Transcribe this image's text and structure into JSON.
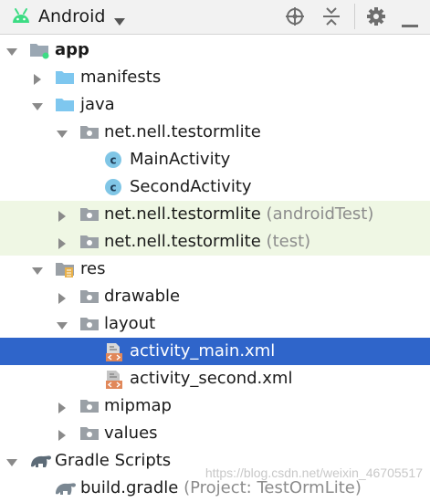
{
  "toolbar": {
    "view_icon": "android-icon",
    "view_label": "Android",
    "dropdown_icon": "chevron-down-icon",
    "actions": [
      "target-icon",
      "collapse-all-icon",
      "gear-icon",
      "hide-icon"
    ]
  },
  "tree": [
    {
      "label": "app",
      "suffix": "",
      "icon": "module-folder-icon",
      "expanded": true
    },
    {
      "label": "manifests",
      "suffix": "",
      "icon": "folder-icon",
      "expanded": false
    },
    {
      "label": "java",
      "suffix": "",
      "icon": "folder-icon",
      "expanded": true
    },
    {
      "label": "net.nell.testormlite",
      "suffix": "",
      "icon": "package-icon",
      "expanded": true
    },
    {
      "label": "MainActivity",
      "suffix": "",
      "icon": "class-icon"
    },
    {
      "label": "SecondActivity",
      "suffix": "",
      "icon": "class-icon"
    },
    {
      "label": "net.nell.testormlite",
      "suffix": "(androidTest)",
      "icon": "package-icon",
      "expanded": false
    },
    {
      "label": "net.nell.testormlite",
      "suffix": "(test)",
      "icon": "package-icon",
      "expanded": false
    },
    {
      "label": "res",
      "suffix": "",
      "icon": "resource-folder-icon",
      "expanded": true
    },
    {
      "label": "drawable",
      "suffix": "",
      "icon": "package-icon",
      "expanded": false
    },
    {
      "label": "layout",
      "suffix": "",
      "icon": "package-icon",
      "expanded": true
    },
    {
      "label": "activity_main.xml",
      "suffix": "",
      "icon": "layout-file-icon",
      "selected": true
    },
    {
      "label": "activity_second.xml",
      "suffix": "",
      "icon": "layout-file-icon"
    },
    {
      "label": "mipmap",
      "suffix": "",
      "icon": "package-icon",
      "expanded": false
    },
    {
      "label": "values",
      "suffix": "",
      "icon": "package-icon",
      "expanded": false
    },
    {
      "label": "Gradle Scripts",
      "suffix": "",
      "icon": "gradle-icon",
      "expanded": true
    },
    {
      "label": "build.gradle",
      "suffix": "(Project: TestOrmLite)",
      "icon": "gradle-file-icon"
    }
  ],
  "watermark": "https://blog.csdn.net/weixin_46705517",
  "colors": {
    "selection": "#2f65ca",
    "test_row_bg": "#eff7e4",
    "folder": "#7ec7ef",
    "class_icon": "#80c6e6",
    "android_green": "#3ddc84",
    "xml_orange": "#e1885a"
  }
}
